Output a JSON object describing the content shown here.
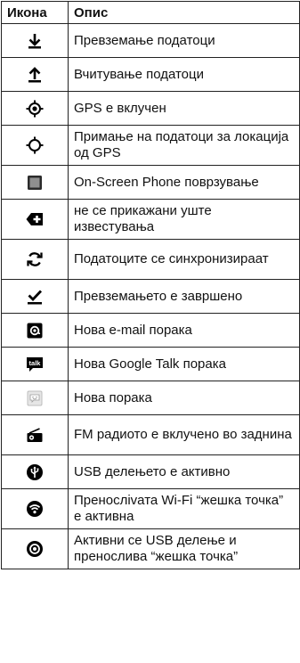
{
  "header": {
    "icon_col": "Икона",
    "desc_col": "Опис"
  },
  "rows": [
    {
      "icon": "download-icon",
      "text": "Превземање податоци"
    },
    {
      "icon": "upload-icon",
      "text": "Вчитување податоци"
    },
    {
      "icon": "gps-on-icon",
      "text": "GPS е вклучен"
    },
    {
      "icon": "gps-acquiring-icon",
      "text": "Примање на податоци за локација од GPS"
    },
    {
      "icon": "on-screen-phone-icon",
      "text": "On-Screen Phone поврзување"
    },
    {
      "icon": "more-notifications-icon",
      "text": "не се прикажани уште известувања"
    },
    {
      "icon": "sync-icon",
      "text": "Податоците се синхронизираат"
    },
    {
      "icon": "download-complete-icon",
      "text": "Превземањето е завршено"
    },
    {
      "icon": "email-icon",
      "text": "Нова e-mail порака"
    },
    {
      "icon": "talk-icon",
      "text": "Нова Google Talk порака",
      "icon_label": "talk"
    },
    {
      "icon": "message-icon",
      "text": "Нова порака"
    },
    {
      "icon": "fm-radio-icon",
      "text": "FM радиото е вклучено во заднина"
    },
    {
      "icon": "usb-tethering-icon",
      "text": "USB делењето е активно"
    },
    {
      "icon": "wifi-hotspot-icon",
      "text": "Пренослivата Wi-Fi “жешка точка” е активна"
    },
    {
      "icon": "usb-and-hotspot-icon",
      "text": "Активни се USB делење и преносливa “жешка точка”"
    }
  ]
}
